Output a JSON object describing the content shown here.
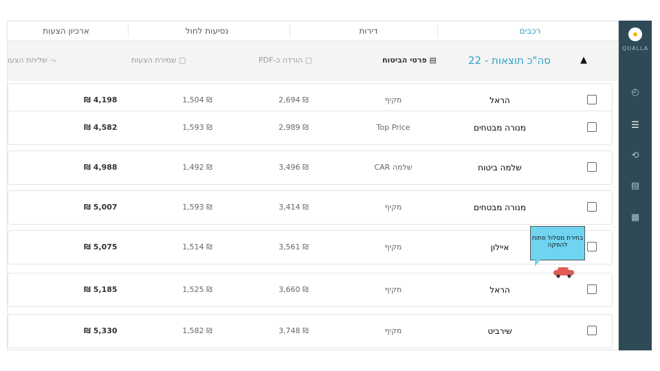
{
  "tabs": [
    "רכבים",
    "דירות",
    "נסיעות לחול",
    "ארכיון הצעות"
  ],
  "toolbar": {
    "results_label": "סה\"כ תוצאות - 22",
    "insurance_details": "פרטי הביטוח",
    "download_pdf": "הורדה כ-PDF",
    "save_offers": "שמירת הצעות",
    "send_offers": "שליחת הצעו"
  },
  "sidebar": {
    "logo_text": "QUALLA"
  },
  "tooltip": "בחירת מסלול פתוח להפקה",
  "rows": [
    {
      "brand": "הראל",
      "type": "מקיף",
      "pdf": "₪ 2,694",
      "save": "₪ 1,504",
      "total": "₪ 4,198"
    },
    {
      "brand": "מנורה מבטחים",
      "type": "Top Price",
      "pdf": "₪ 2,989",
      "save": "₪ 1,593",
      "total": "₪ 4,582"
    },
    {
      "brand": "שלמה ביטוח",
      "type": "שלמה CAR",
      "pdf": "₪ 3,496",
      "save": "₪ 1,492",
      "total": "₪ 4,988"
    },
    {
      "brand": "מנורה מבטחים",
      "type": "מקיף",
      "pdf": "₪ 3,414",
      "save": "₪ 1,593",
      "total": "₪ 5,007"
    },
    {
      "brand": "איילון",
      "type": "מקיף",
      "pdf": "₪ 3,561",
      "save": "₪ 1,514",
      "total": "₪ 5,075"
    },
    {
      "brand": "הראל",
      "type": "מקיף",
      "pdf": "₪ 3,660",
      "save": "₪ 1,525",
      "total": "₪ 5,185"
    },
    {
      "brand": "שירביט",
      "type": "מקיף",
      "pdf": "₪ 3,748",
      "save": "₪ 1,582",
      "total": "₪ 5,330"
    }
  ],
  "colors": {
    "accent": "#2aa3c9",
    "sidebar": "#2f4a57",
    "tooltip": "#6fd4f0"
  }
}
